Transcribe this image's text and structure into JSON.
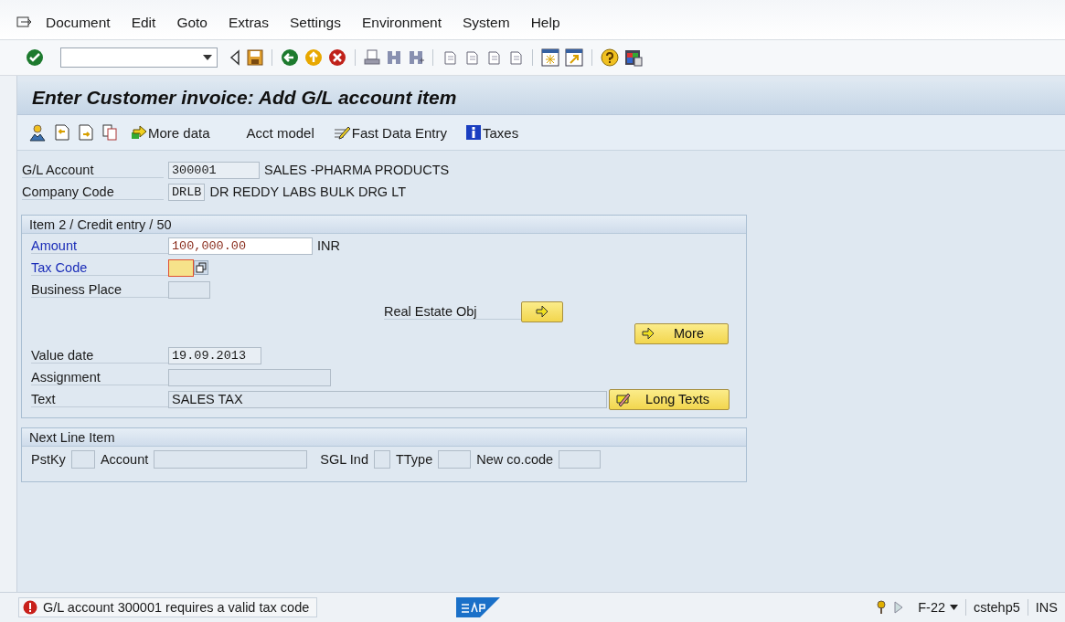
{
  "menu": [
    {
      "label": "Document"
    },
    {
      "label": "Edit"
    },
    {
      "label": "Goto"
    },
    {
      "label": "Extras"
    },
    {
      "label": "Settings"
    },
    {
      "label": "Environment"
    },
    {
      "label": "System"
    },
    {
      "label": "Help"
    }
  ],
  "title": "Enter Customer invoice: Add G/L account item",
  "app_toolbar": [
    {
      "label": "More data"
    },
    {
      "label": "Acct model"
    },
    {
      "label": "Fast Data Entry"
    },
    {
      "label": "Taxes"
    }
  ],
  "header_fields": [
    {
      "label": "G/L Account",
      "value": "300001",
      "description": "SALES -PHARMA PRODUCTS"
    },
    {
      "label": "Company Code",
      "value": "DRLB",
      "description": "DR REDDY LABS BULK DRG LT"
    }
  ],
  "item": {
    "title": "Item 2 / Credit entry / 50",
    "amount": {
      "label": "Amount",
      "required": true,
      "value": "100,000.00",
      "unit": "INR"
    },
    "tax_code": {
      "label": "Tax Code",
      "required": true,
      "error": true
    },
    "business_place": {
      "label": "Business Place",
      "required": false
    },
    "real_estate": {
      "label": "Real Estate Obj"
    },
    "more_button": {
      "label": "More"
    },
    "value_date": {
      "label": "Value date",
      "required": false,
      "value": "19.09.2013"
    },
    "assignment": {
      "label": "Assignment",
      "required": false
    },
    "text": {
      "label": "Text",
      "required": false,
      "value": "SALES TAX"
    },
    "long_texts_button": {
      "label": "Long Texts"
    }
  },
  "next_line_item": {
    "title": "Next Line Item",
    "fields": [
      {
        "label": "PstKy"
      },
      {
        "label": "Account"
      },
      {
        "label": "SGL Ind"
      },
      {
        "label": "TType"
      },
      {
        "label": "New co.code"
      }
    ]
  },
  "status_bar": {
    "message": "G/L account 300001 requires a valid tax code",
    "transaction": "F-22",
    "system": "cstehp5",
    "mode": "INS"
  }
}
